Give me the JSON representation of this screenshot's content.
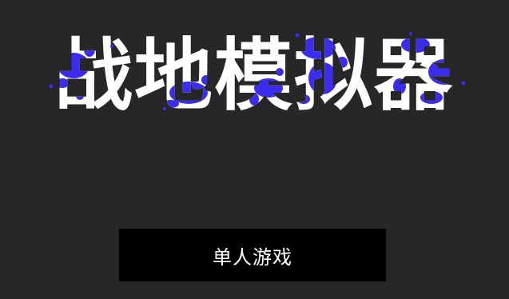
{
  "game": {
    "title": "战地模拟器",
    "title_color": "#ffffff",
    "splatter_color": "#3a2cf0",
    "background_color": "#272727"
  },
  "menu": {
    "single_player_label": "单人游戏",
    "button_color": "#000000",
    "label_color": "#ffffff"
  }
}
